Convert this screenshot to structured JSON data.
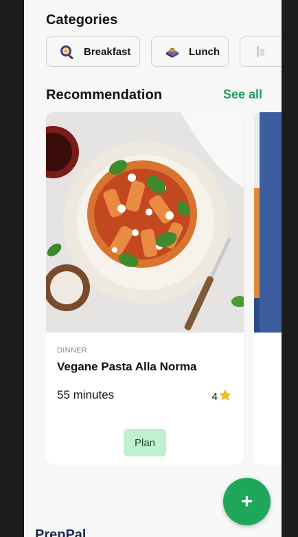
{
  "categories": {
    "title": "Categories",
    "items": [
      {
        "label": "Breakfast",
        "icon": "breakfast-pan-icon"
      },
      {
        "label": "Lunch",
        "icon": "lunch-box-icon"
      },
      {
        "label": "",
        "icon": "dinner-icon"
      }
    ]
  },
  "recommendation": {
    "title": "Recommendation",
    "see_all": "See all",
    "cards": [
      {
        "tag": "DINNER",
        "title": "Vegane Pasta Alla Norma",
        "time": "55 minutes",
        "rating": "4",
        "plan_label": "Plan"
      }
    ]
  },
  "fab": {
    "label": "+"
  },
  "footer": {
    "brand": "PrepPal"
  },
  "colors": {
    "accent": "#1ea75a",
    "plan_bg": "#bff0cf",
    "app_bg": "#f7f7f7"
  }
}
